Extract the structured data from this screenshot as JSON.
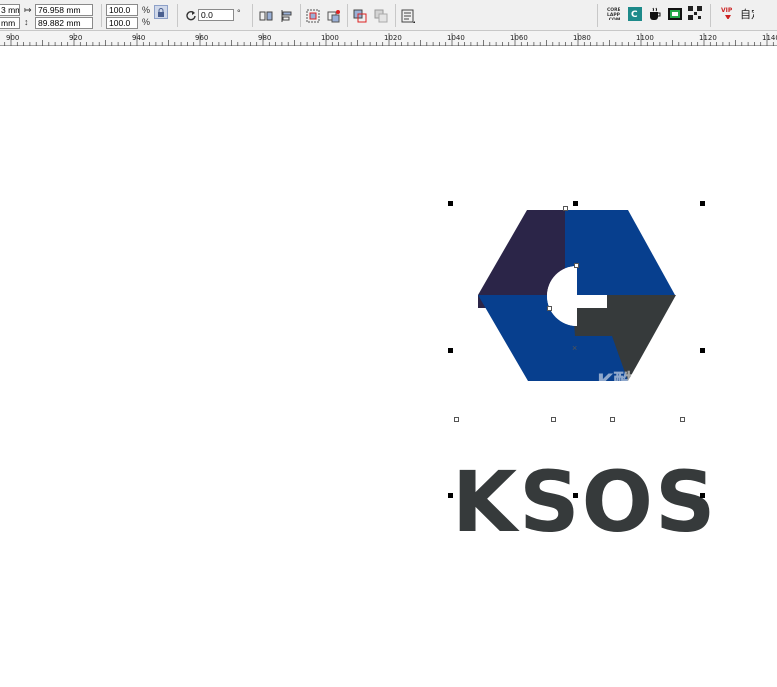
{
  "toolbar": {
    "x_partial": "3 mm",
    "y_partial": "mm",
    "width": "76.958 mm",
    "height": "89.882 mm",
    "scale_x": "100.0",
    "scale_y": "100.0",
    "percent": "%",
    "rotation": "0.0",
    "degree": "°"
  },
  "ruler": {
    "labels": [
      "900",
      "920",
      "940",
      "960",
      "980",
      "1000",
      "1020",
      "1040",
      "1060",
      "1080",
      "1100",
      "1120",
      "1140"
    ]
  },
  "canvas": {
    "logo_text": "KSOS",
    "watermark": "K酷",
    "watermark_url": "WWW."
  },
  "colors": {
    "logo_dark": "#2b2548",
    "logo_blue": "#073f8e",
    "logo_gray": "#363a3b"
  }
}
